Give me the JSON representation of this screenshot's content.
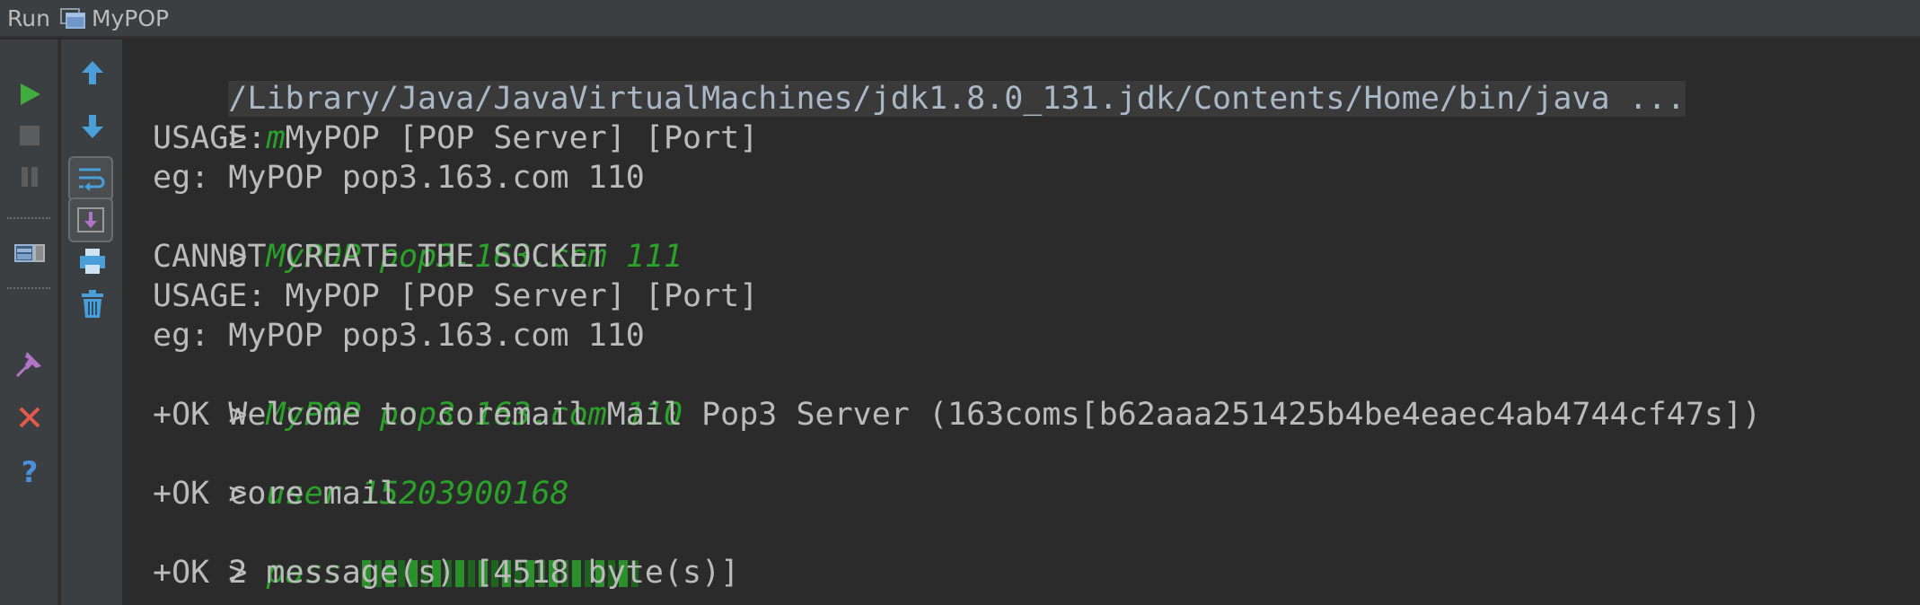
{
  "titlebar": {
    "run_label": "Run",
    "config_name": "MyPOP"
  },
  "toolbar_left": {
    "items": [
      {
        "name": "run-icon",
        "color": "#3fae3f"
      },
      {
        "name": "stop-icon",
        "color": "#6b6b6b"
      },
      {
        "name": "pause-icon",
        "color": "#6b6b6b"
      },
      {
        "name": "restore-layout-icon",
        "color": "#6f97c7"
      },
      {
        "name": "pin-icon",
        "color": "#b174c7"
      },
      {
        "name": "close-icon",
        "color": "#e25a4c"
      },
      {
        "name": "help-icon",
        "color": "#4a90d9"
      }
    ]
  },
  "toolbar_right": {
    "items": [
      {
        "name": "up-arrow-icon",
        "color": "#4a9fd9"
      },
      {
        "name": "down-arrow-icon",
        "color": "#4a9fd9"
      },
      {
        "name": "soft-wrap-icon",
        "color": "#4a9fd9"
      },
      {
        "name": "scroll-to-end-icon",
        "color": "#b174c7"
      },
      {
        "name": "print-icon",
        "color": "#4a9fd9"
      },
      {
        "name": "trash-icon",
        "color": "#4a9fd9"
      }
    ]
  },
  "console": {
    "lines": [
      {
        "type": "cmd",
        "text": "/Library/Java/JavaVirtualMachines/jdk1.8.0_131.jdk/Contents/Home/bin/java ..."
      },
      {
        "type": "input",
        "prompt": "> ",
        "text": "m"
      },
      {
        "type": "output",
        "text": "USAGE: MyPOP [POP Server] [Port]"
      },
      {
        "type": "output",
        "text": "eg: MyPOP pop3.163.com 110"
      },
      {
        "type": "input",
        "prompt": "> ",
        "text": "MyPOP pop3.163.com 111"
      },
      {
        "type": "output",
        "text": "CANNOT CREATE THE SOCKET"
      },
      {
        "type": "output",
        "text": "USAGE: MyPOP [POP Server] [Port]"
      },
      {
        "type": "output",
        "text": "eg: MyPOP pop3.163.com 110"
      },
      {
        "type": "input",
        "prompt": "> ",
        "text": "MyPOP pop3.163.com 110"
      },
      {
        "type": "output",
        "text": "+OK Welcome to coremail Mail Pop3 Server (163coms[b62aaa251425b4be4eaec4ab4744cf47s])"
      },
      {
        "type": "input",
        "prompt": "> ",
        "text": "user 15203900168"
      },
      {
        "type": "output",
        "text": "+OK core mail"
      },
      {
        "type": "input",
        "prompt": "> ",
        "text": "pass"
      },
      {
        "type": "output",
        "text": "+OK 2 message(s) [4518 byte(s)]"
      }
    ]
  },
  "colors": {
    "background": "#2b2b2b",
    "toolbar": "#3c3f41",
    "output_text": "#bbbbbb",
    "input_text": "#2aa22a"
  }
}
